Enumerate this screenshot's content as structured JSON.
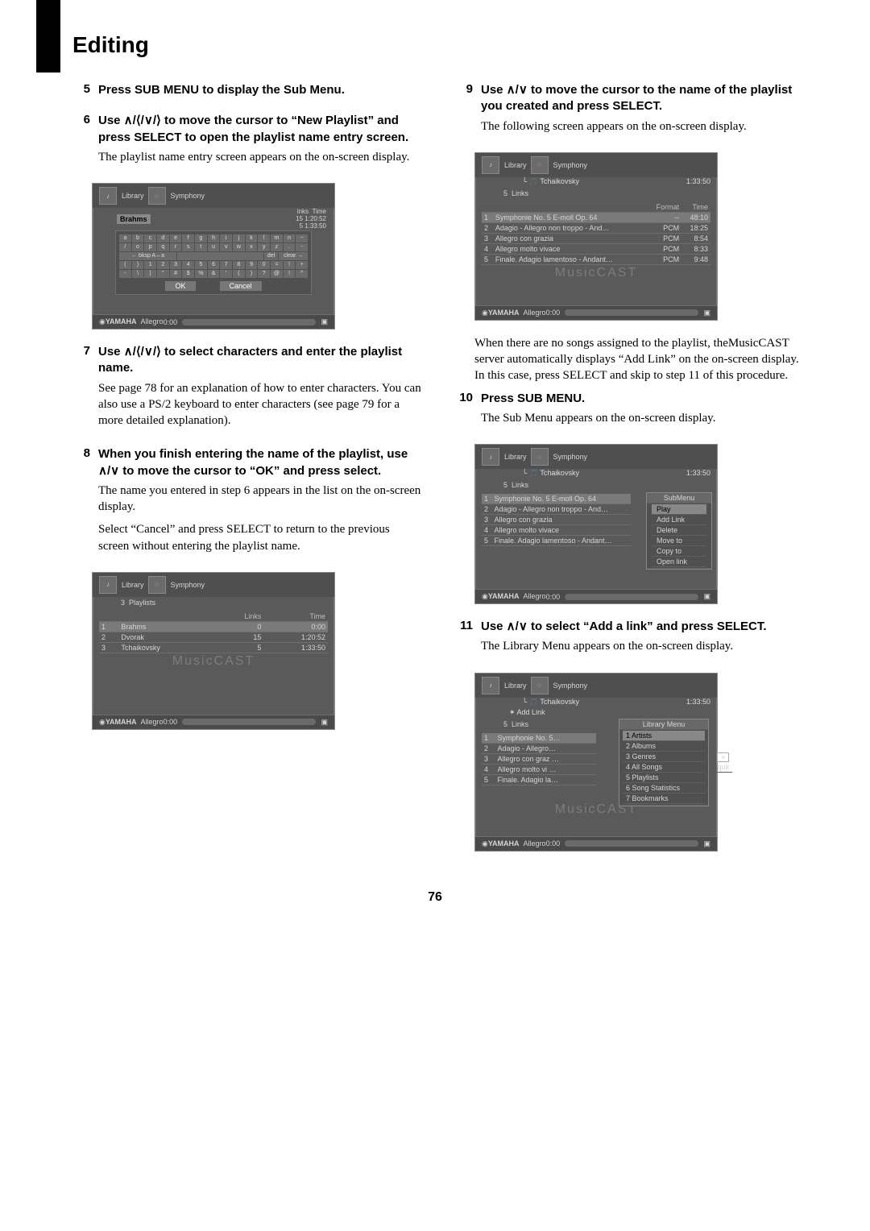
{
  "page_title": "Editing",
  "page_number": "76",
  "steps": {
    "s5": {
      "num": "5",
      "title": "Press SUB MENU to display the Sub Menu."
    },
    "s6": {
      "num": "6",
      "title": "Use ∧/⟨/∨/⟩ to move the cursor to “New Playlist” and press SELECT to open the playlist name entry screen.",
      "text": "The playlist name entry screen appears on the on-screen display."
    },
    "s7": {
      "num": "7",
      "title": "Use ∧/⟨/∨/⟩ to select characters and enter the playlist name.",
      "text": "See page 78 for an explanation of how to enter characters. You can also use a PS/2 keyboard to enter characters (see page 79 for a more detailed explanation)."
    },
    "s8": {
      "num": "8",
      "title": "When you finish entering the name of the playlist, use ∧/∨ to move the cursor to “OK” and press select.",
      "text1": "The name you entered in step 6 appears in the list on the on-screen display.",
      "text2": "Select “Cancel” and press SELECT to return to the previous screen without entering the playlist name."
    },
    "s9": {
      "num": "9",
      "title": "Use ∧/∨ to move the cursor to the name of the playlist you created and press SELECT.",
      "text1": "The following screen appears on the on-screen display.",
      "text2": "When there are no songs assigned to the playlist, theMusicCAST server automatically displays “Add Link” on the on-screen display. In this case, press SELECT and skip to step 11 of this procedure."
    },
    "s10": {
      "num": "10",
      "title": "Press SUB MENU.",
      "text": "The Sub Menu appears on the on-screen display."
    },
    "s11": {
      "num": "11",
      "title": "Use ∧/∨ to select “Add a link” and press SELECT.",
      "text": "The Library Menu appears on the on-screen display."
    }
  },
  "ss1": {
    "breadcrumb_a": "Library",
    "breadcrumb_b": "Symphony",
    "entry": "Brahms",
    "links_label": "inks",
    "time_label": "Time",
    "r1_links": "15",
    "r1_time": "1:20:52",
    "r2_links": "5",
    "r2_time": "1:33:50",
    "kb_bksp": "← bksp A↔a",
    "kb_del": "del",
    "kb_clear": "clear →",
    "ok": "OK",
    "cancel": "Cancel",
    "brand": "YAMAHA",
    "song": "Allegro",
    "pos": "0:00"
  },
  "ss2": {
    "breadcrumb_a": "Library",
    "breadcrumb_b": "Symphony",
    "count": "3",
    "list_title": "Playlists",
    "links_h": "Links",
    "time_h": "Time",
    "rows": [
      {
        "n": "1",
        "name": "Brahms",
        "links": "0",
        "time": "0:00",
        "sel": true
      },
      {
        "n": "2",
        "name": "Dvorak",
        "links": "15",
        "time": "1:20:52"
      },
      {
        "n": "3",
        "name": "Tchaikovsky",
        "links": "5",
        "time": "1:33:50"
      }
    ],
    "wm": "MusicCAST",
    "brand": "YAMAHA",
    "song": "Allegro",
    "pos": "0:00"
  },
  "ss3": {
    "breadcrumb_a": "Library",
    "breadcrumb_b": "Symphony",
    "breadcrumb_c": "Tchaikovsky",
    "total": "1:33:50",
    "count": "5",
    "list_title": "Links",
    "format_h": "Format",
    "time_h": "Time",
    "rows": [
      {
        "n": "1",
        "name": "Symphonie No. 5 E-moll Op. 64",
        "fmt": "--",
        "time": "48:10",
        "sel": true
      },
      {
        "n": "2",
        "name": "Adagio - Allegro non troppo - And…",
        "fmt": "PCM",
        "time": "18:25"
      },
      {
        "n": "3",
        "name": "Allegro con grazia",
        "fmt": "PCM",
        "time": "8:54"
      },
      {
        "n": "4",
        "name": "Allegro molto vivace",
        "fmt": "PCM",
        "time": "8:33"
      },
      {
        "n": "5",
        "name": "Finale. Adagio lamentoso - Andant…",
        "fmt": "PCM",
        "time": "9:48"
      }
    ],
    "wm": "MusicCAST",
    "brand": "YAMAHA",
    "song": "Allegro",
    "pos": "0:00"
  },
  "ss4": {
    "breadcrumb_a": "Library",
    "breadcrumb_b": "Symphony",
    "breadcrumb_c": "Tchaikovsky",
    "total": "1:33:50",
    "count": "5",
    "list_title": "Links",
    "rows": [
      {
        "n": "1",
        "name": "Symphonie No. 5 E-moll Op. 64",
        "sel": true
      },
      {
        "n": "2",
        "name": "Adagio - Allegro non troppo - And…"
      },
      {
        "n": "3",
        "name": "Allegro con grazia"
      },
      {
        "n": "4",
        "name": "Allegro molto vivace"
      },
      {
        "n": "5",
        "name": "Finale. Adagio lamentoso - Andant…"
      }
    ],
    "submenu_title": "SubMenu",
    "submenu": [
      "Play",
      "Add Link",
      "Delete",
      "Move to",
      "Copy to",
      "Open link"
    ],
    "brand": "YAMAHA",
    "song": "Allegro",
    "pos": "0:00"
  },
  "ss5": {
    "breadcrumb_a": "Library",
    "breadcrumb_b": "Symphony",
    "breadcrumb_c": "Tchaikovsky",
    "total": "1:33:50",
    "addlink": "Add Link",
    "count": "5",
    "list_title": "Links",
    "rows": [
      {
        "n": "1",
        "name": "Symphonie No. 5…",
        "sel": true
      },
      {
        "n": "2",
        "name": "Adagio - Allegro…"
      },
      {
        "n": "3",
        "name": "Allegro con graz …"
      },
      {
        "n": "4",
        "name": "Allegro molto vi …"
      },
      {
        "n": "5",
        "name": "Finale. Adagio la…"
      }
    ],
    "libmenu_title": "Library Menu",
    "libmenu": [
      {
        "n": "1",
        "name": "Artists",
        "sel": true
      },
      {
        "n": "2",
        "name": "Albums"
      },
      {
        "n": "3",
        "name": "Genres"
      },
      {
        "n": "4",
        "name": "All Songs"
      },
      {
        "n": "5",
        "name": "Playlists"
      },
      {
        "n": "6",
        "name": "Song Statistics"
      },
      {
        "n": "7",
        "name": "Bookmarks"
      }
    ],
    "quit_x": "×",
    "quit_label": "quit",
    "wm": "MusicCAST",
    "brand": "YAMAHA",
    "song": "Allegro",
    "pos": "0:00"
  }
}
